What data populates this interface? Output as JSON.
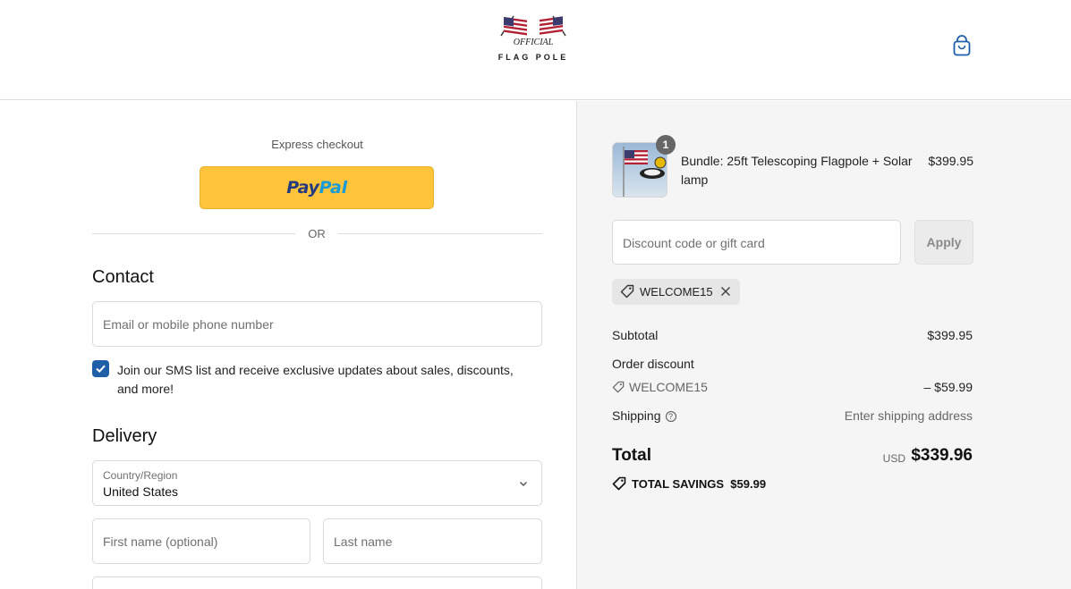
{
  "brand": {
    "tagline": "OFFICIAL",
    "name": "FLAG POLE"
  },
  "header": {
    "cart_icon": "shopping-bag-icon"
  },
  "checkout": {
    "express_label": "Express checkout",
    "paypal_pay": "Pay",
    "paypal_pal": "Pal",
    "or_label": "OR",
    "contact_title": "Contact",
    "email_placeholder": "Email or mobile phone number",
    "sms_optin_checked": true,
    "sms_optin_label": "Join our SMS list and receive exclusive updates about sales, discounts, and more!",
    "delivery_title": "Delivery",
    "country_label": "Country/Region",
    "country_value": "United States",
    "first_name_placeholder": "First name (optional)",
    "last_name_placeholder": "Last name"
  },
  "summary": {
    "product": {
      "quantity": "1",
      "name": "Bundle: 25ft Telescoping Flagpole + Solar lamp",
      "price": "$399.95"
    },
    "discount_placeholder": "Discount code or gift card",
    "apply_label": "Apply",
    "applied_code": "WELCOME15",
    "subtotal_label": "Subtotal",
    "subtotal_value": "$399.95",
    "order_discount_label": "Order discount",
    "order_discount_code": "WELCOME15",
    "order_discount_value": "– $59.99",
    "shipping_label": "Shipping",
    "shipping_value": "Enter shipping address",
    "total_label": "Total",
    "total_currency": "USD",
    "total_value": "$339.96",
    "savings_label": "TOTAL SAVINGS",
    "savings_value": "$59.99"
  },
  "colors": {
    "paypal_yellow": "#ffc439",
    "checkbox_blue": "#1f5fa8",
    "summary_bg": "#f5f5f5"
  }
}
